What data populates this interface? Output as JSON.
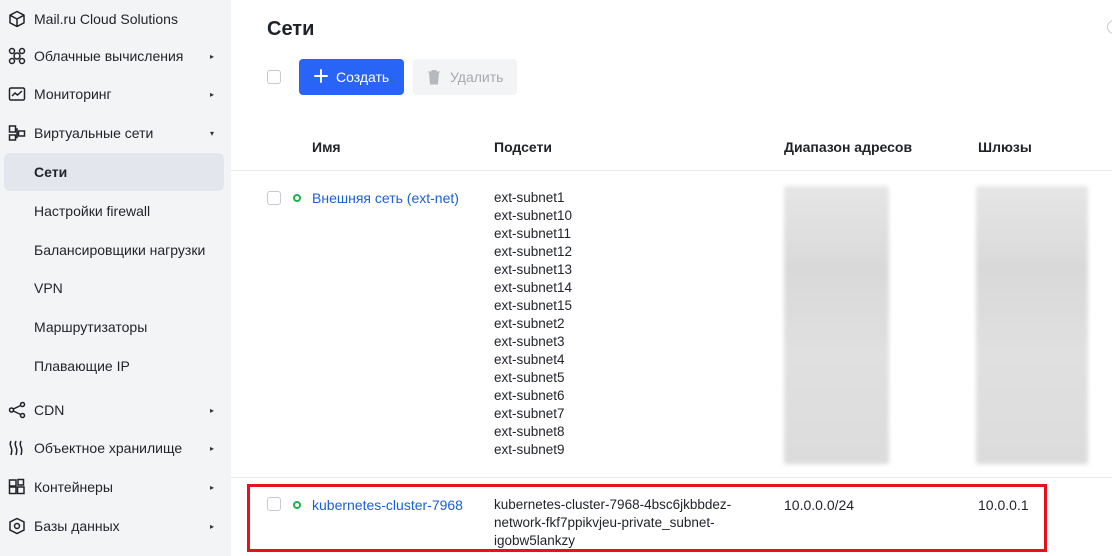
{
  "sidebar": {
    "brand": "Mail.ru Cloud Solutions",
    "items": [
      {
        "label": "Облачные вычисления",
        "icon": "cloud-compute-icon",
        "arrow": "▸"
      },
      {
        "label": "Мониторинг",
        "icon": "monitoring-icon",
        "arrow": "▸"
      },
      {
        "label": "Виртуальные сети",
        "icon": "virtual-network-icon",
        "arrow": "▾"
      },
      {
        "label": "CDN",
        "icon": "cdn-icon",
        "arrow": "▸"
      },
      {
        "label": "Объектное хранилище",
        "icon": "object-storage-icon",
        "arrow": "▸"
      },
      {
        "label": "Контейнеры",
        "icon": "containers-icon",
        "arrow": "▸"
      },
      {
        "label": "Базы данных",
        "icon": "databases-icon",
        "arrow": "▸"
      }
    ],
    "subitems": [
      {
        "label": "Сети",
        "active": true
      },
      {
        "label": "Настройки firewall"
      },
      {
        "label": "Балансировщики нагрузки"
      },
      {
        "label": "VPN"
      },
      {
        "label": "Маршрутизаторы"
      },
      {
        "label": "Плавающие IP"
      }
    ]
  },
  "page": {
    "title": "Сети",
    "create_label": "Создать",
    "delete_label": "Удалить"
  },
  "table": {
    "headers": [
      "Имя",
      "Подсети",
      "Диапазон адресов",
      "Шлюзы"
    ],
    "rows": [
      {
        "name": "Внешняя сеть (ext-net)",
        "subnets": [
          "ext-subnet1",
          "ext-subnet10",
          "ext-subnet11",
          "ext-subnet12",
          "ext-subnet13",
          "ext-subnet14",
          "ext-subnet15",
          "ext-subnet2",
          "ext-subnet3",
          "ext-subnet4",
          "ext-subnet5",
          "ext-subnet6",
          "ext-subnet7",
          "ext-subnet8",
          "ext-subnet9"
        ],
        "address_range": "",
        "gateways": ""
      },
      {
        "name": "kubernetes-cluster-7968",
        "subnets_lines": [
          "kubernetes-cluster-7968-4bsc6jkbbdez-",
          "network-fkf7ppikvjeu-private_subnet-",
          "igobw5lankzy"
        ],
        "address_range": "10.0.0.0/24",
        "gateways": "10.0.0.1"
      }
    ]
  },
  "colors": {
    "accent": "#2864f5",
    "link": "#1a5fd6",
    "status_ok": "#20b24b",
    "highlight": "#e8101a"
  }
}
